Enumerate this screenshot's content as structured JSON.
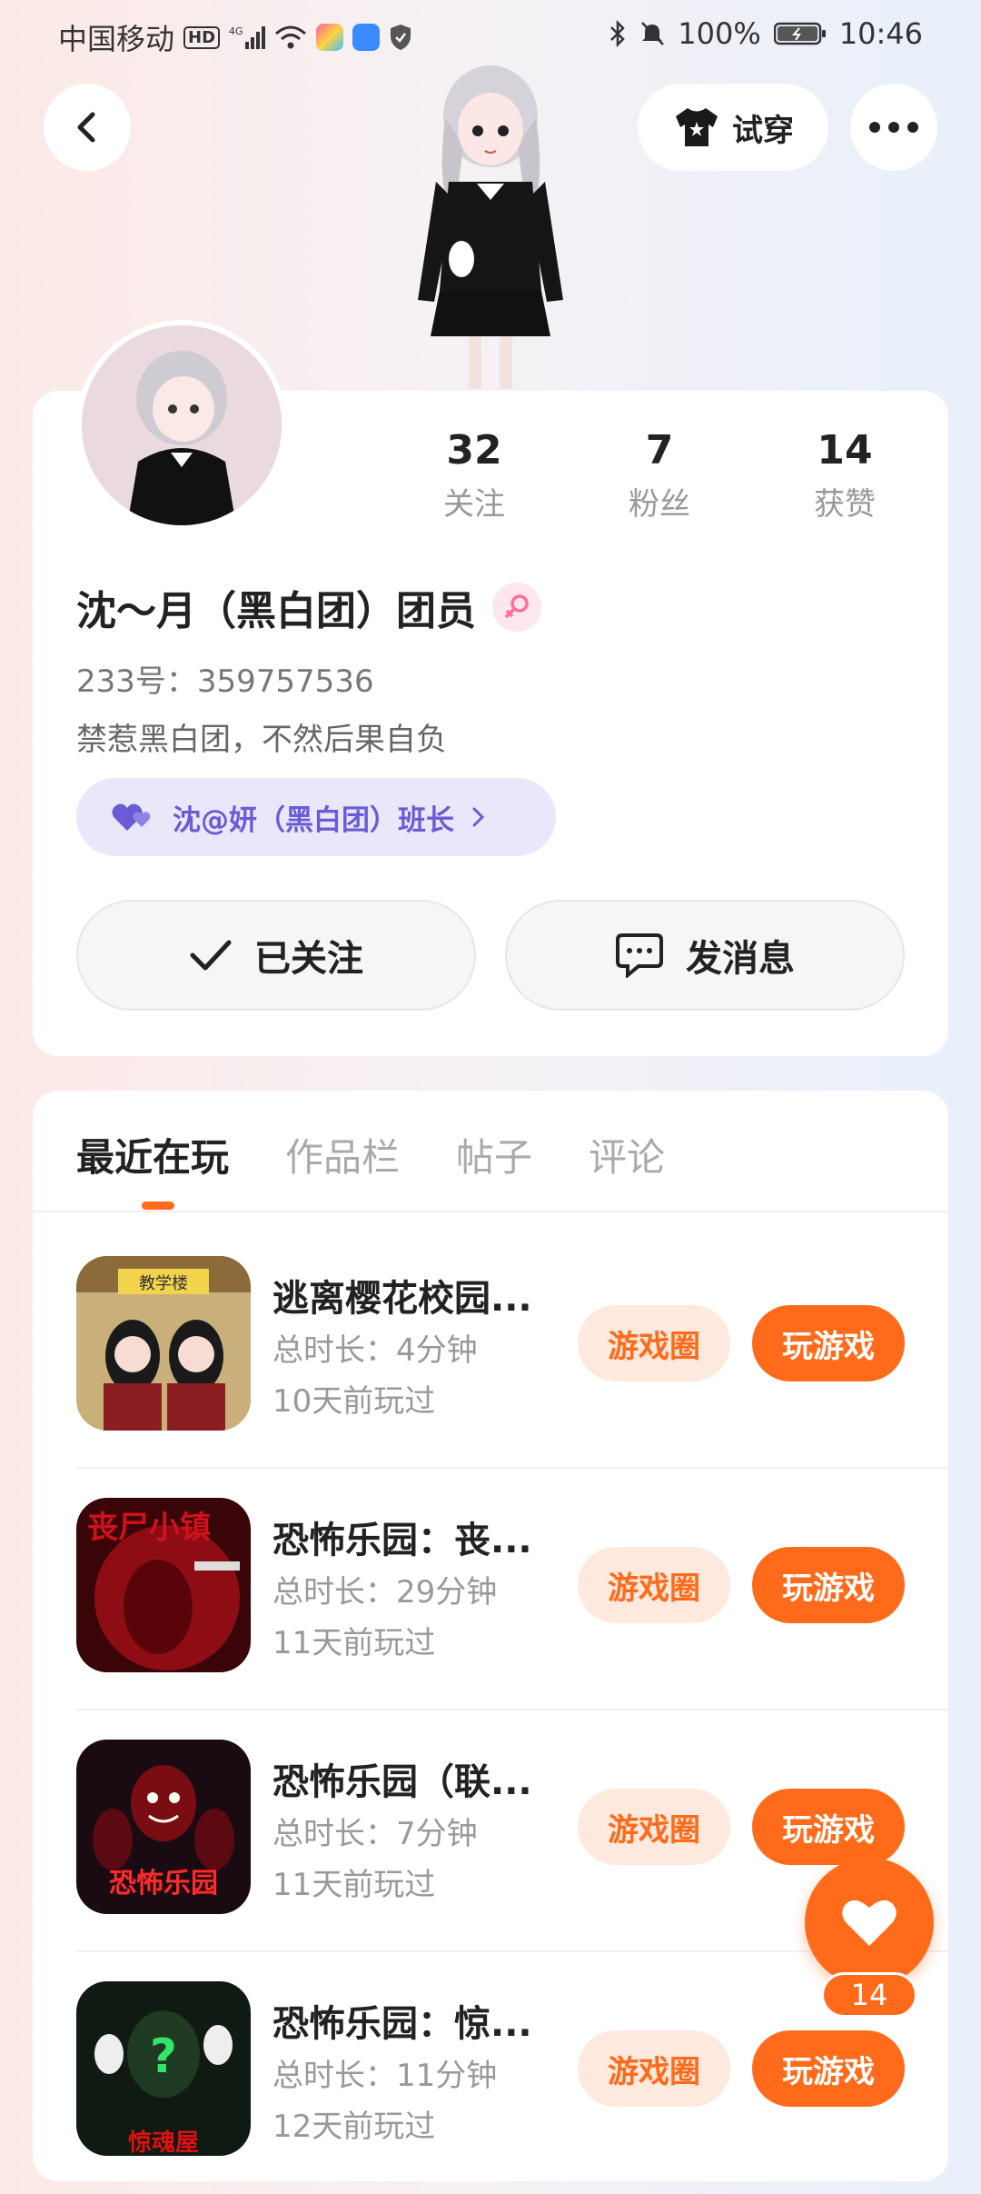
{
  "status_bar": {
    "carrier": "中国移动",
    "hd": "HD",
    "network": "4G",
    "battery": "100%",
    "time": "10:46"
  },
  "top_bar": {
    "tryon_label": "试穿"
  },
  "profile": {
    "stats": [
      {
        "num": "32",
        "label": "关注"
      },
      {
        "num": "7",
        "label": "粉丝"
      },
      {
        "num": "14",
        "label": "获赞"
      }
    ],
    "name": "沈～月（黑白团）团员",
    "uid": "233号：359757536",
    "bio": "禁惹黑白团，不然后果自负",
    "relation": "沈@妍（黑白团）班长",
    "followed_label": "已关注",
    "message_label": "发消息"
  },
  "tabs": [
    "最近在玩",
    "作品栏",
    "帖子",
    "评论"
  ],
  "games": [
    {
      "title": "逃离樱花校园...",
      "duration": "总时长：4分钟",
      "last_played": "10天前玩过",
      "icon_text": "教学楼"
    },
    {
      "title": "恐怖乐园：丧...",
      "duration": "总时长：29分钟",
      "last_played": "11天前玩过",
      "icon_text": "丧尸小镇"
    },
    {
      "title": "恐怖乐园（联...",
      "duration": "总时长：7分钟",
      "last_played": "11天前玩过",
      "icon_text": "恐怖乐园"
    },
    {
      "title": "恐怖乐园：惊...",
      "duration": "总时长：11分钟",
      "last_played": "12天前玩过",
      "icon_text": "惊魂屋"
    }
  ],
  "game_buttons": {
    "circle_label": "游戏圈",
    "play_label": "玩游戏"
  },
  "like_fab": {
    "count": "14"
  },
  "colors": {
    "accent": "#ff6b1a",
    "accent_soft": "#fde9dd",
    "relation_bg": "#e9e8fb",
    "relation_text": "#6b5bd6"
  }
}
